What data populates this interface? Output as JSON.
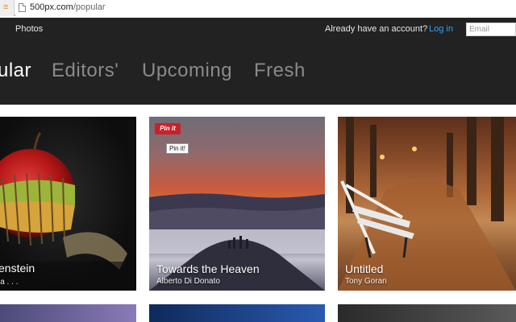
{
  "browser": {
    "url_domain": "500px.com",
    "url_path": "/popular"
  },
  "nav": {
    "photos_label": "Photos",
    "account_prompt": "Already have an account?",
    "login_label": "Log in",
    "email_placeholder": "Email"
  },
  "tabs": [
    {
      "label": "ular",
      "active": true
    },
    {
      "label": "Editors'",
      "active": false
    },
    {
      "label": "Upcoming",
      "active": false
    },
    {
      "label": "Fresh",
      "active": false
    }
  ],
  "photos": [
    {
      "title": "enstein",
      "author": "la . . ."
    },
    {
      "title": "Towards the Heaven",
      "author": "Alberto Di Donato",
      "pin_badge": "Pin it",
      "pin_tooltip": "Pin it!"
    },
    {
      "title": "Untitled",
      "author": "Tony Goran"
    }
  ],
  "colors": {
    "accent": "#e8912c",
    "nav_bg": "#222222",
    "login_link": "#2ea3f2",
    "pinit": "#cb2027"
  }
}
